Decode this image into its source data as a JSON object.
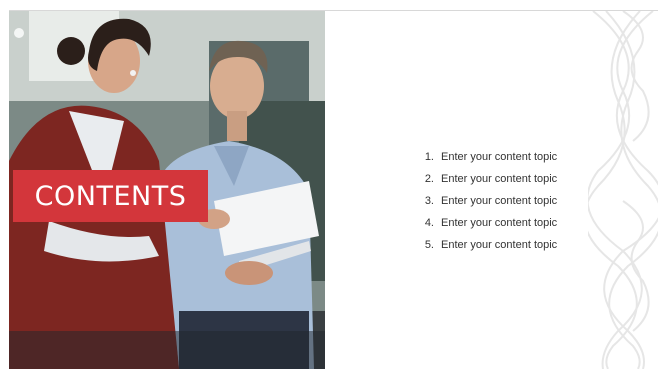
{
  "slide": {
    "title": "CONTENTS",
    "topics": [
      {
        "number": "1.",
        "label": "Enter your content topic"
      },
      {
        "number": "2.",
        "label": "Enter your content topic"
      },
      {
        "number": "3.",
        "label": "Enter your content topic"
      },
      {
        "number": "4.",
        "label": "Enter your content topic"
      },
      {
        "number": "5.",
        "label": "Enter your content topic"
      }
    ]
  },
  "colors": {
    "accent": "#d3363b",
    "text": "#333333",
    "pattern": "#e6e6e6"
  },
  "icons": {
    "photo": "business-meeting-photo",
    "pattern": "braid-pattern"
  }
}
